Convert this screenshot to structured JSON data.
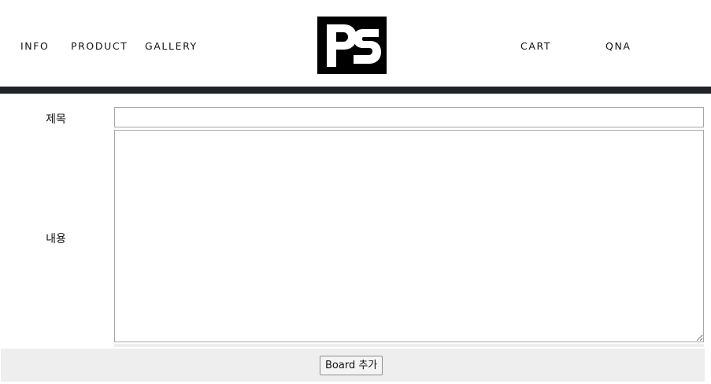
{
  "nav": {
    "left": [
      "INFO",
      "PRODUCT",
      "GALLERY"
    ],
    "right": [
      "CART",
      "QNA"
    ]
  },
  "logo": {
    "text": "PS",
    "background": "#000000",
    "foreground": "#ffffff"
  },
  "form": {
    "title_label": "제목",
    "title_value": "",
    "content_label": "내용",
    "content_value": "",
    "submit_label": "Board 추가"
  },
  "colors": {
    "divider": "#1f2227",
    "footer": "#eeeeee",
    "field_border": "#a7a7a7"
  }
}
